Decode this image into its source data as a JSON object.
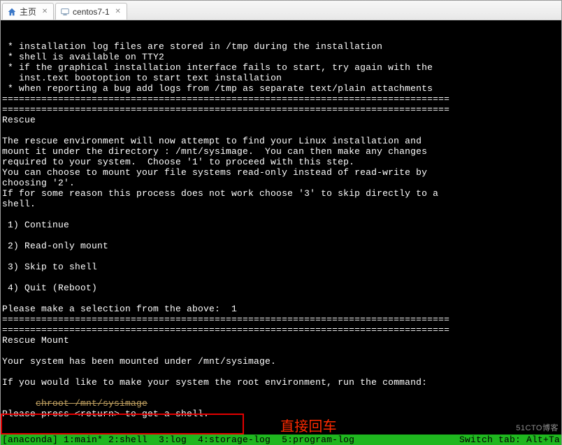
{
  "tabs": [
    {
      "label": "主页",
      "icon": "home-icon",
      "active": false
    },
    {
      "label": "centos7-1",
      "icon": "vm-icon",
      "active": true
    }
  ],
  "terminal": {
    "bullets": [
      "installation log files are stored in /tmp during the installation",
      "shell is available on TTY2",
      "if the graphical installation interface fails to start, try again with the",
      "inst.text bootoption to start text installation",
      "when reporting a bug add logs from /tmp as separate text/plain attachments"
    ],
    "separator": "================================================================================",
    "rescue_title": "Rescue",
    "rescue_body": [
      "The rescue environment will now attempt to find your Linux installation and",
      "mount it under the directory : /mnt/sysimage.  You can then make any changes",
      "required to your system.  Choose '1' to proceed with this step.",
      "You can choose to mount your file systems read-only instead of read-write by",
      "choosing '2'.",
      "If for some reason this process does not work choose '3' to skip directly to a",
      "shell."
    ],
    "options": {
      "o1": "1) Continue",
      "o2": "2) Read-only mount",
      "o3": "3) Skip to shell",
      "o4": "4) Quit (Reboot)"
    },
    "prompt_line": "Please make a selection from the above:  1",
    "mount_title": "Rescue Mount",
    "mount_line": "Your system has been mounted under /mnt/sysimage.",
    "env_line": "If you would like to make your system the root environment, run the command:",
    "chroot_line": "chroot /mnt/sysimage",
    "press_line": "Please press <return> to get a shell.",
    "annotation": "直接回车",
    "status": {
      "left": "[anaconda] 1:main* 2:shell  3:log  4:storage-log  5:program-log",
      "right": "Switch tab: Alt+Ta"
    }
  },
  "watermark": "51CTO博客"
}
